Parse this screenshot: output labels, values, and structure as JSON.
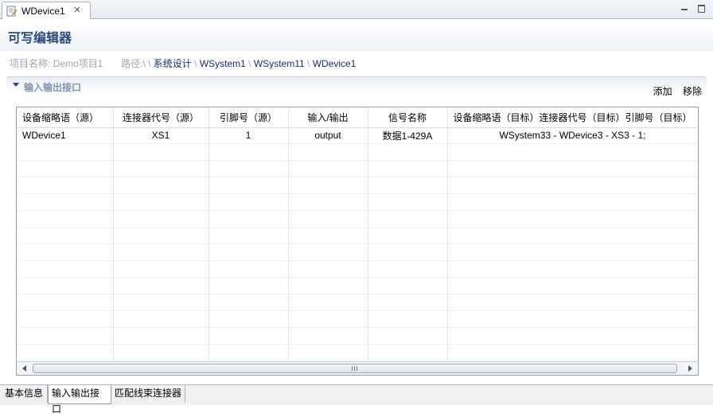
{
  "editor_tab": {
    "title": "WDevice1"
  },
  "form": {
    "title": "可写编辑器"
  },
  "info": {
    "project_label": "项目名称:",
    "project_name": "Demo项目1",
    "path_label": "路径:\\",
    "path_sep": "\\",
    "breadcrumbs": [
      "系统设计",
      "WSystem1",
      "WSystem11",
      "WDevice1"
    ]
  },
  "section": {
    "title": "输入输出接口",
    "add_label": "添加",
    "remove_label": "移除"
  },
  "table": {
    "columns": [
      "设备缩略语（源）",
      "连接器代号（源）",
      "引脚号（源）",
      "输入/输出",
      "信号名称",
      "设备缩略语（目标）连接器代号（目标）引脚号（目标）"
    ],
    "rows": [
      [
        "WDevice1",
        "XS1",
        "1",
        "output",
        "数据1-429A",
        "WSystem33 - WDevice3 - XS3 - 1;"
      ]
    ]
  },
  "page_tabs": [
    "基本信息",
    "输入输出接口",
    "匹配线束连接器"
  ],
  "active_page_tab": "输入输出接口"
}
